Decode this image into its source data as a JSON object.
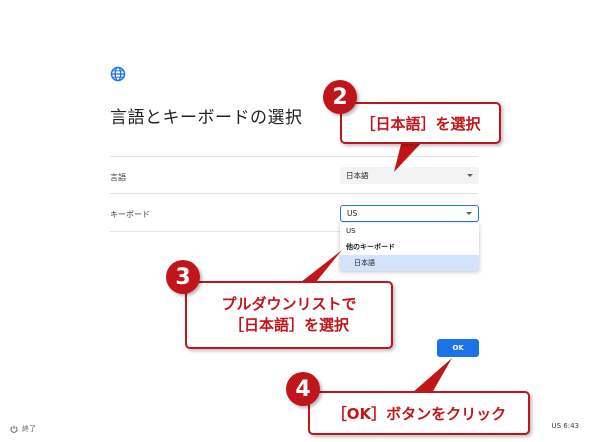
{
  "header": {
    "title": "言語とキーボードの選択"
  },
  "language": {
    "label": "言語",
    "selected": "日本語"
  },
  "keyboard": {
    "label": "キーボード",
    "selected": "US",
    "options": [
      {
        "type": "item",
        "label": "US"
      },
      {
        "type": "group",
        "label": "他のキーボード"
      },
      {
        "type": "item",
        "label": "日本語",
        "highlighted": true
      }
    ]
  },
  "ok_button": "OK",
  "footer": {
    "shutdown_label": "終了",
    "status": "US  6:43"
  },
  "annotations": {
    "badge2": "2",
    "callout2": "［日本語］を選択",
    "badge3": "3",
    "callout3_line1": "プルダウンリストで",
    "callout3_line2": "［日本語］を選択",
    "badge4": "4",
    "callout4": "［OK］ボタンをクリック",
    "color": "#c0161b"
  },
  "colors": {
    "accent": "#1a73e8",
    "highlight": "#d2e3fc"
  }
}
